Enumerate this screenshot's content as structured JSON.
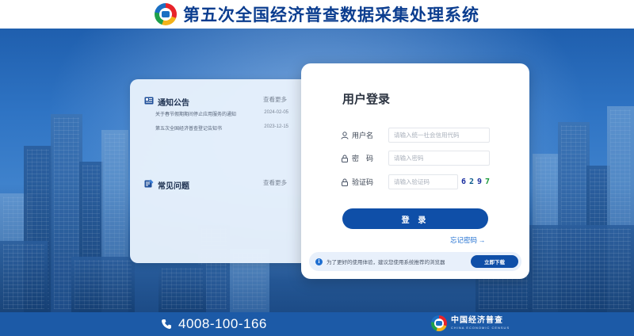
{
  "header": {
    "title": "第五次全国经济普查数据采集处理系统",
    "logo_icon": "census-logo-icon"
  },
  "notices": {
    "title": "通知公告",
    "more": "查看更多",
    "items": [
      {
        "text": "关于春节假期期间停止应用服务的通知",
        "date": "2024-02-05"
      },
      {
        "text": "第五次全国经济普查登记告知书",
        "date": "2023-12-15"
      }
    ]
  },
  "faq": {
    "title": "常见问题",
    "more": "查看更多"
  },
  "login": {
    "title": "用户登录",
    "username_label": "用户名",
    "username_placeholder": "请输入统一社会信用代码",
    "password_label": "密　码",
    "password_placeholder": "请输入密码",
    "captcha_label": "验证码",
    "captcha_placeholder": "请输入验证码",
    "captcha_digits": [
      {
        "char": "6",
        "color": "#1a2fa0"
      },
      {
        "char": "2",
        "color": "#0a5a8a"
      },
      {
        "char": "9",
        "color": "#1a2fa0"
      },
      {
        "char": "7",
        "color": "#1a9a3a"
      }
    ],
    "submit_label": "登 录",
    "forgot_label": "忘记密码",
    "forgot_arrow": "→",
    "tip_text": "为了更好的使用体验，建议您使用系统推荐的浏览器",
    "download_label": "立即下载"
  },
  "footer": {
    "phone": "4008-100-166",
    "brand_cn": "中国经济普查",
    "brand_en": "CHINA ECONOMIC CENSUS"
  },
  "colors": {
    "primary": "#0f4fa8",
    "title": "#0b3d8f",
    "footer_bg": "#1c5aa7",
    "link": "#1f6fd1"
  }
}
